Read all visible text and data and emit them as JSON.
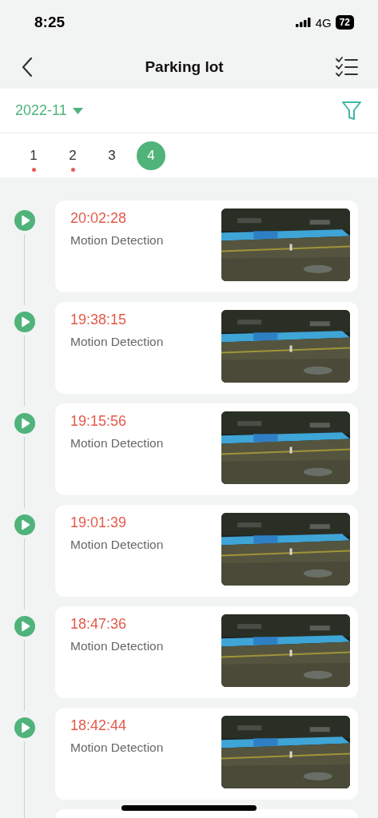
{
  "status_bar": {
    "time": "8:25",
    "network": "4G",
    "battery": "72"
  },
  "nav": {
    "title": "Parking lot"
  },
  "month": {
    "label": "2022-11"
  },
  "days": [
    {
      "label": "1",
      "dot": true,
      "selected": false
    },
    {
      "label": "2",
      "dot": true,
      "selected": false
    },
    {
      "label": "3",
      "dot": false,
      "selected": false
    },
    {
      "label": "4",
      "dot": false,
      "selected": true
    }
  ],
  "events": [
    {
      "time": "20:02:28",
      "type": "Motion Detection"
    },
    {
      "time": "19:38:15",
      "type": "Motion Detection"
    },
    {
      "time": "19:15:56",
      "type": "Motion Detection"
    },
    {
      "time": "19:01:39",
      "type": "Motion Detection"
    },
    {
      "time": "18:47:36",
      "type": "Motion Detection"
    },
    {
      "time": "18:42:44",
      "type": "Motion Detection"
    }
  ]
}
